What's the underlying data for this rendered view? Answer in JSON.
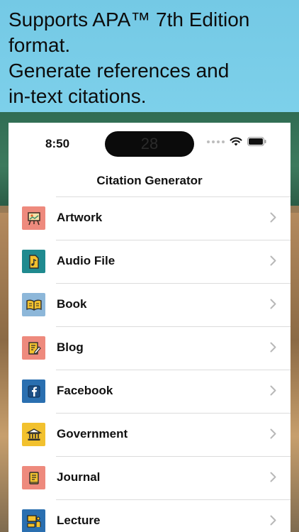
{
  "banner": {
    "line1": "Supports APA™ 7th Edition",
    "line2": "format.",
    "line3": "Generate references and",
    "line4": "in-text citations."
  },
  "status": {
    "time": "8:50",
    "island_text": "28"
  },
  "nav": {
    "title": "Citation Generator"
  },
  "items": [
    {
      "label": "Artwork",
      "icon": "easel-icon",
      "color": "#ee8a7d"
    },
    {
      "label": "Audio File",
      "icon": "music-file-icon",
      "color": "#1f8a8f"
    },
    {
      "label": "Book",
      "icon": "open-book-icon",
      "color": "#8db7d9"
    },
    {
      "label": "Blog",
      "icon": "edit-note-icon",
      "color": "#ee8a7d"
    },
    {
      "label": "Facebook",
      "icon": "facebook-icon",
      "color": "#2a6fb0"
    },
    {
      "label": "Government",
      "icon": "bank-icon",
      "color": "#f2c12e"
    },
    {
      "label": "Journal",
      "icon": "journal-icon",
      "color": "#ee8a7d"
    },
    {
      "label": "Lecture",
      "icon": "presentation-icon",
      "color": "#2a6fb0"
    }
  ]
}
